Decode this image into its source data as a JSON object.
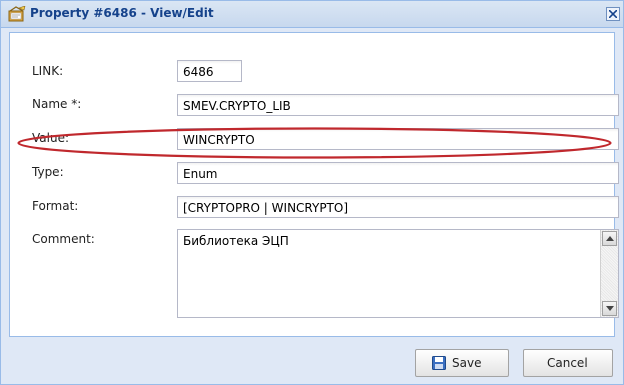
{
  "window": {
    "title": "Property #6486 - View/Edit",
    "icon": "property-edit-icon",
    "close_icon": "close-icon"
  },
  "form": {
    "link": {
      "label": "LINK:",
      "value": "6486"
    },
    "name": {
      "label": "Name *:",
      "value": "SMEV.CRYPTO_LIB"
    },
    "value": {
      "label": "Value:",
      "value": "WINCRYPTO"
    },
    "type": {
      "label": "Type:",
      "value": "Enum"
    },
    "format": {
      "label": "Format:",
      "value": "[CRYPTOPRO | WINCRYPTO]"
    },
    "comment": {
      "label": "Comment:",
      "value": "Библиотека ЭЦП"
    }
  },
  "buttons": {
    "save": {
      "label": "Save",
      "icon": "floppy-disk-icon"
    },
    "cancel": {
      "label": "Cancel"
    }
  },
  "colors": {
    "title_text": "#15428b",
    "highlight_oval": "#c0282d",
    "panel_border": "#99bbe8",
    "dialog_bg": "#dfe8f6"
  }
}
